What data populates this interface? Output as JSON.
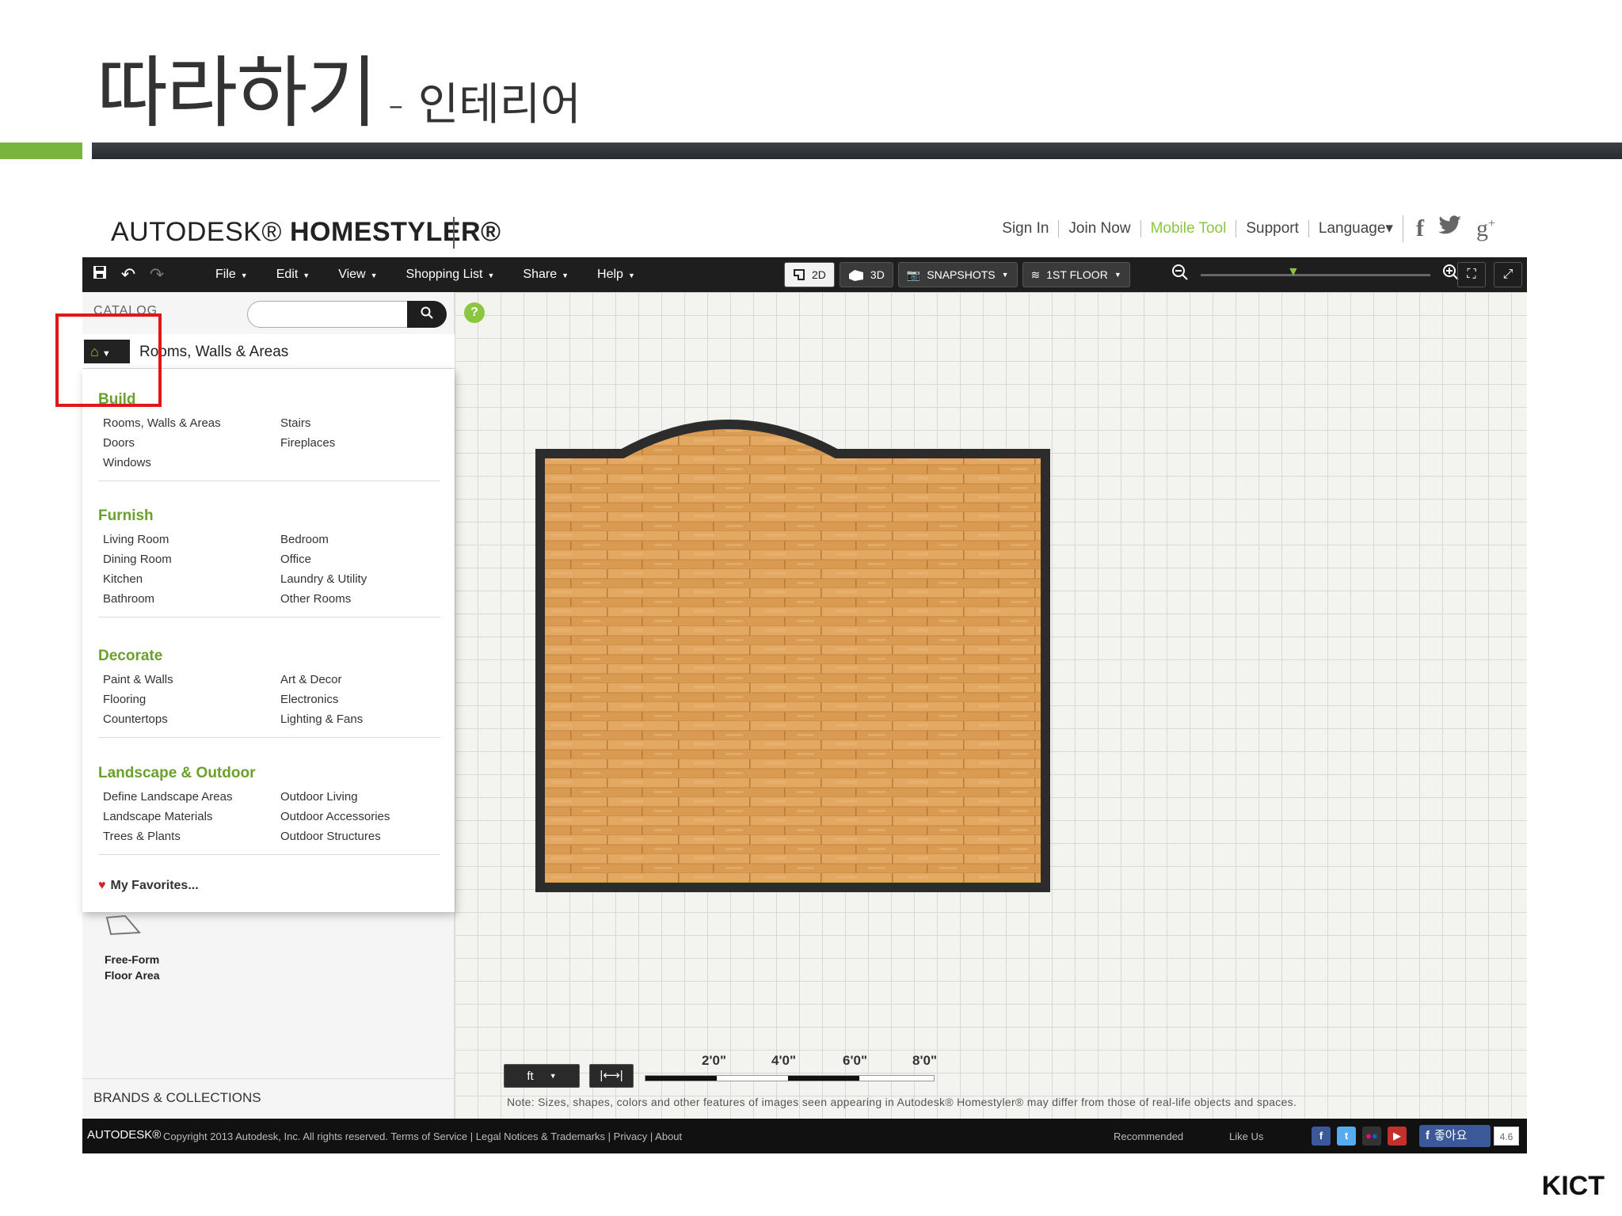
{
  "slide": {
    "title_main": "따라하기",
    "title_sub": "- 인테리어",
    "org": "KICT"
  },
  "app": {
    "brand_light": "AUTODESK®",
    "brand_bold": "HOMESTYLER®",
    "top_links": [
      "Sign In",
      "Join Now",
      "Mobile Tool",
      "Support",
      "Language▾"
    ],
    "social_icons": [
      "facebook-icon",
      "twitter-icon",
      "google-plus-icon"
    ],
    "accent_color": "#8cc63f"
  },
  "toolbar": {
    "menu": [
      "File",
      "Edit",
      "View",
      "Shopping List",
      "Share",
      "Help"
    ],
    "view_2d": "2D",
    "view_3d": "3D",
    "snapshots": "SNAPSHOTS",
    "floor": "1ST FLOOR",
    "zoom_level": 0.4
  },
  "catalog": {
    "label": "CATALOG",
    "current_category": "Rooms, Walls & Areas",
    "sections": [
      {
        "title": "Build",
        "items": [
          "Rooms, Walls & Areas",
          "Stairs",
          "Doors",
          "Fireplaces",
          "Windows"
        ]
      },
      {
        "title": "Furnish",
        "items": [
          "Living Room",
          "Bedroom",
          "Dining Room",
          "Office",
          "Kitchen",
          "Laundry & Utility",
          "Bathroom",
          "Other Rooms"
        ]
      },
      {
        "title": "Decorate",
        "items": [
          "Paint & Walls",
          "Art & Decor",
          "Flooring",
          "Electronics",
          "Countertops",
          "Lighting & Fans"
        ]
      },
      {
        "title": "Landscape & Outdoor",
        "items": [
          "Define Landscape Areas",
          "Outdoor Living",
          "Landscape Materials",
          "Outdoor Accessories",
          "Trees & Plants",
          "Outdoor Structures"
        ]
      }
    ],
    "favorites": "My Favorites...",
    "freeform_label_1": "Free-Form",
    "freeform_label_2": "Floor Area",
    "brands": "BRANDS & COLLECTIONS"
  },
  "canvas": {
    "units": "ft",
    "measure_icon": "|⟷|",
    "scale_labels": [
      "2'0\"",
      "4'0\"",
      "6'0\"",
      "8'0\""
    ],
    "note": "Note: Sizes, shapes, colors and other features of images seen appearing in Autodesk® Homestyler® may differ from those of real-life objects and spaces."
  },
  "footer": {
    "logo": "AUTODESK®",
    "copyright": "Copyright 2013 Autodesk, Inc. All rights reserved. Terms of Service | Legal Notices & Trademarks | Privacy | About",
    "recommended": "Recommended",
    "like_us": "Like Us",
    "fb_like": "좋아요",
    "like_count": "4.6"
  }
}
